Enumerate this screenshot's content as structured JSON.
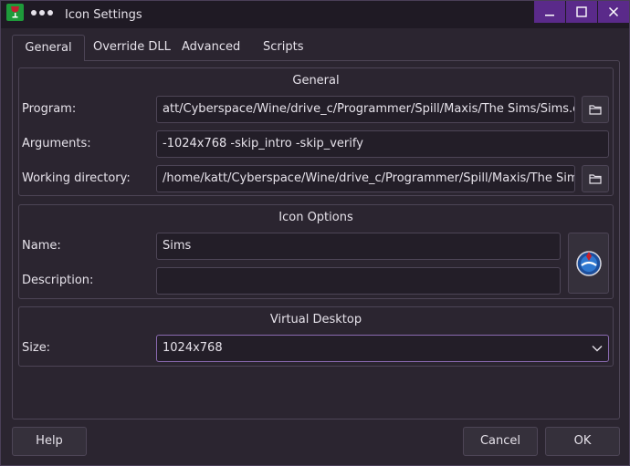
{
  "window": {
    "title": "Icon Settings",
    "controls": {
      "minimize": "minimize-icon",
      "maximize": "maximize-icon",
      "close": "close-icon"
    }
  },
  "tabs": [
    {
      "label": "General",
      "active": true
    },
    {
      "label": "Override DLL",
      "active": false
    },
    {
      "label": "Advanced",
      "active": false
    },
    {
      "label": "Scripts",
      "active": false
    }
  ],
  "general": {
    "title": "General",
    "program_label": "Program:",
    "program_value": "att/Cyberspace/Wine/drive_c/Programmer/Spill/Maxis/The Sims/Sims.exe",
    "arguments_label": "Arguments:",
    "arguments_value": "-1024x768 -skip_intro -skip_verify",
    "workdir_label": "Working directory:",
    "workdir_value": "/home/katt/Cyberspace/Wine/drive_c/Programmer/Spill/Maxis/The Sims/"
  },
  "icon_options": {
    "title": "Icon Options",
    "name_label": "Name:",
    "name_value": "Sims",
    "description_label": "Description:",
    "description_value": ""
  },
  "virtual_desktop": {
    "title": "Virtual Desktop",
    "size_label": "Size:",
    "size_value": "1024x768"
  },
  "buttons": {
    "help": "Help",
    "cancel": "Cancel",
    "ok": "OK"
  },
  "colors": {
    "accent": "#5a2a8a",
    "focus_border": "#8a6ab0",
    "background": "#2b2530"
  }
}
